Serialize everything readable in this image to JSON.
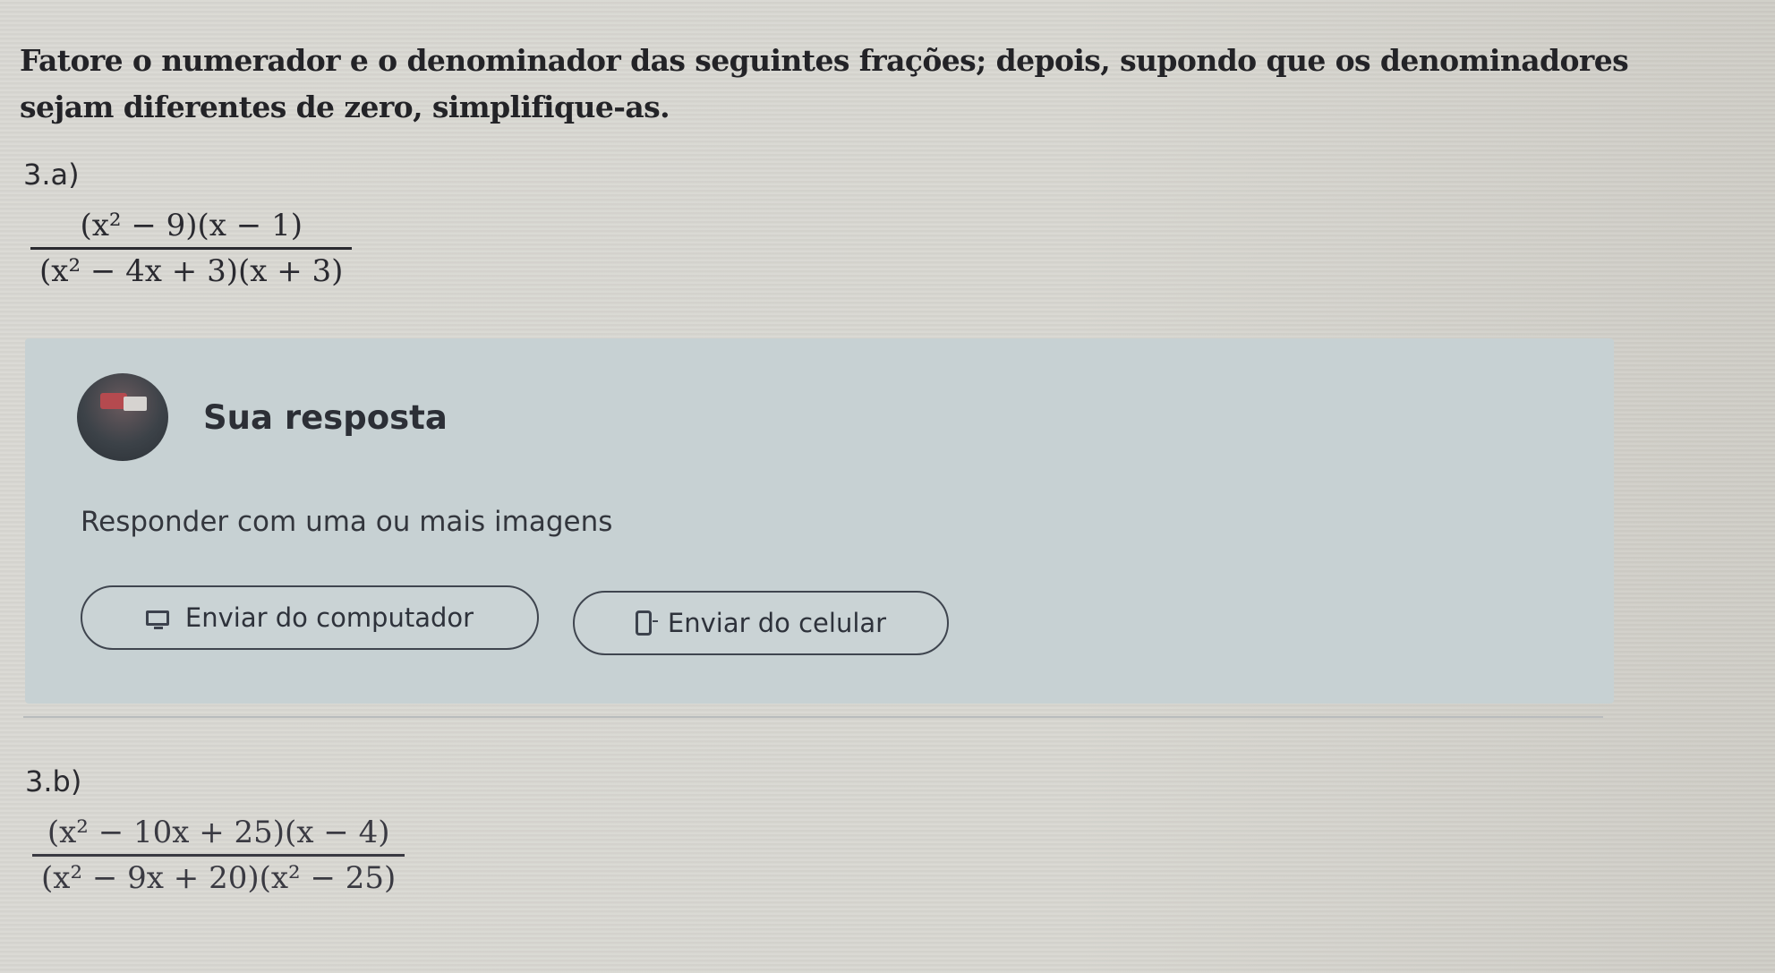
{
  "instructions": "Fatore o numerador e o denominador das seguintes frações; depois, supondo que os denominadores sejam diferentes de zero, simplifique-as.",
  "questions": [
    {
      "label": "3.a)",
      "numerator": "(x² − 9)(x − 1)",
      "denominator": "(x² − 4x + 3)(x + 3)"
    },
    {
      "label": "3.b)",
      "numerator": "(x² − 10x + 25)(x − 4)",
      "denominator": "(x² − 9x + 20)(x² − 25)"
    }
  ],
  "answer_panel": {
    "title": "Sua resposta",
    "subtitle": "Responder com uma ou mais imagens",
    "upload_computer_label": "Enviar do computador",
    "upload_phone_label": "Enviar do celular",
    "upload_computer_icon": "monitor-icon",
    "upload_phone_icon": "phone-icon",
    "avatar_icon": "avatar"
  }
}
